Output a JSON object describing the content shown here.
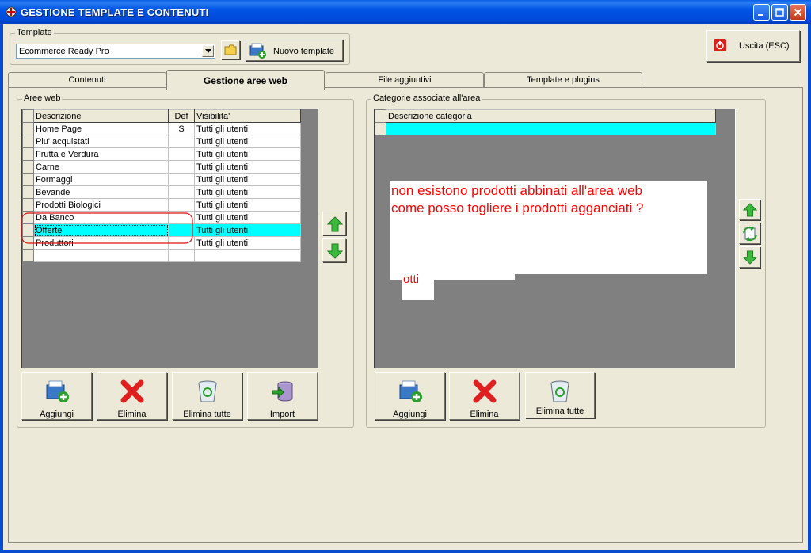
{
  "window": {
    "title": "GESTIONE TEMPLATE E CONTENUTI"
  },
  "template": {
    "group_label": "Template",
    "selected": "Ecommerce Ready Pro",
    "new_button": "Nuovo template"
  },
  "exit_button": "Uscita (ESC)",
  "tabs": [
    {
      "label": "Contenuti",
      "active": false
    },
    {
      "label": "Gestione aree web",
      "active": true
    },
    {
      "label": "File aggiuntivi",
      "active": false
    },
    {
      "label": "Template e plugins",
      "active": false
    }
  ],
  "aree_web": {
    "group_label": "Aree web",
    "columns": [
      "Descrizione",
      "Def",
      "Visibilita'"
    ],
    "rows": [
      {
        "descrizione": "Home Page",
        "def": "S",
        "visibilita": "Tutti gli utenti"
      },
      {
        "descrizione": "Piu' acquistati",
        "def": "",
        "visibilita": "Tutti gli utenti"
      },
      {
        "descrizione": "Frutta e Verdura",
        "def": "",
        "visibilita": "Tutti gli utenti"
      },
      {
        "descrizione": "Carne",
        "def": "",
        "visibilita": "Tutti gli utenti"
      },
      {
        "descrizione": "Formaggi",
        "def": "",
        "visibilita": "Tutti gli utenti"
      },
      {
        "descrizione": "Bevande",
        "def": "",
        "visibilita": "Tutti gli utenti"
      },
      {
        "descrizione": "Prodotti Biologici",
        "def": "",
        "visibilita": "Tutti gli utenti"
      },
      {
        "descrizione": "Da Banco",
        "def": "",
        "visibilita": "Tutti gli utenti"
      },
      {
        "descrizione": "Offerte",
        "def": "",
        "visibilita": "Tutti gli utenti",
        "selected": true
      },
      {
        "descrizione": "Produttori",
        "def": "",
        "visibilita": "Tutti gli utenti"
      }
    ],
    "buttons": {
      "add": "Aggiungi",
      "delete": "Elimina",
      "delete_all": "Elimina tutte",
      "import": "Import"
    }
  },
  "categorie": {
    "group_label": "Categorie associate all'area",
    "columns": [
      "Descrizione categoria"
    ],
    "buttons": {
      "add": "Aggiungi",
      "delete": "Elimina",
      "delete_all": "Elimina tutte"
    }
  },
  "annotation": {
    "line1": "non esistono prodotti abbinati all'area web",
    "line2": "come posso togliere i prodotti agganciati ?",
    "fragment": "otti",
    "color": "#ff0000"
  }
}
